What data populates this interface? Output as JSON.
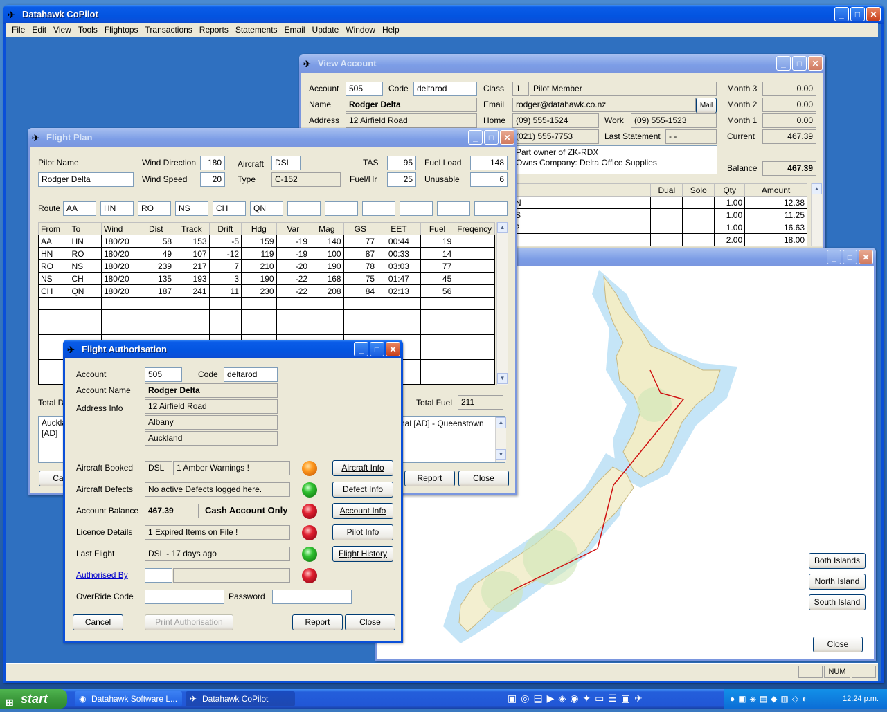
{
  "app": {
    "title": "Datahawk CoPilot"
  },
  "menu": [
    "File",
    "Edit",
    "View",
    "Tools",
    "Flightops",
    "Transactions",
    "Reports",
    "Statements",
    "Email",
    "Update",
    "Window",
    "Help"
  ],
  "view_account": {
    "title": "View Account",
    "account_label": "Account",
    "account": "505",
    "code_label": "Code",
    "code": "deltarod",
    "class_label": "Class",
    "class_no": "1",
    "class_name": "Pilot Member",
    "name_label": "Name",
    "name": "Rodger Delta",
    "email_label": "Email",
    "email": "rodger@datahawk.co.nz",
    "mail_btn": "Mail",
    "address_label": "Address",
    "address": "12 Airfield Road",
    "home_label": "Home",
    "home": "(09) 555-1524",
    "work_label": "Work",
    "work": "(09) 555-1523",
    "mobile": "(021) 555-7753",
    "last_statement_label": "Last Statement",
    "last_statement": "- -",
    "notes": [
      "Part owner of ZK-RDX",
      "Owns Company:  Delta Office Supplies"
    ],
    "month3_label": "Month 3",
    "month3": "0.00",
    "month2_label": "Month 2",
    "month2": "0.00",
    "month1_label": "Month 1",
    "month1": "0.00",
    "current_label": "Current",
    "current": "467.39",
    "balance_label": "Balance",
    "balance": "467.39",
    "table_headers": [
      "Dual",
      "Solo",
      "Qty",
      "Amount"
    ],
    "rows": [
      {
        "c": "N",
        "qty": "1.00",
        "amount": "12.38"
      },
      {
        "c": "S",
        "qty": "1.00",
        "amount": "11.25"
      },
      {
        "c": "2",
        "qty": "1.00",
        "amount": "16.63"
      },
      {
        "c": "",
        "qty": "2.00",
        "amount": "18.00"
      }
    ]
  },
  "flight_plan": {
    "title": "Flight Plan",
    "pilot_name_label": "Pilot Name",
    "pilot_name": "Rodger Delta",
    "wind_dir_label": "Wind Direction",
    "wind_dir": "180",
    "wind_speed_label": "Wind Speed",
    "wind_speed": "20",
    "aircraft_label": "Aircraft",
    "aircraft": "DSL",
    "type_label": "Type",
    "type": "C-152",
    "tas_label": "TAS",
    "tas": "95",
    "fuelhr_label": "Fuel/Hr",
    "fuelhr": "25",
    "fuel_load_label": "Fuel Load",
    "fuel_load": "148",
    "unusable_label": "Unusable",
    "unusable": "6",
    "route_label": "Route",
    "route": [
      "AA",
      "HN",
      "RO",
      "NS",
      "CH",
      "QN",
      "",
      "",
      "",
      "",
      "",
      ""
    ],
    "headers": [
      "From",
      "To",
      "Wind",
      "Dist",
      "Track",
      "Drift",
      "Hdg",
      "Var",
      "Mag",
      "GS",
      "EET",
      "Fuel",
      "Freqency"
    ],
    "legs": [
      [
        "AA",
        "HN",
        "180/20",
        "58",
        "153",
        "-5",
        "159",
        "-19",
        "140",
        "77",
        "00:44",
        "19",
        ""
      ],
      [
        "HN",
        "RO",
        "180/20",
        "49",
        "107",
        "-12",
        "119",
        "-19",
        "100",
        "87",
        "00:33",
        "14",
        ""
      ],
      [
        "RO",
        "NS",
        "180/20",
        "239",
        "217",
        "7",
        "210",
        "-20",
        "190",
        "78",
        "03:03",
        "77",
        ""
      ],
      [
        "NS",
        "CH",
        "180/20",
        "135",
        "193",
        "3",
        "190",
        "-22",
        "168",
        "75",
        "01:47",
        "45",
        ""
      ],
      [
        "CH",
        "QN",
        "180/20",
        "187",
        "241",
        "11",
        "230",
        "-22",
        "208",
        "84",
        "02:13",
        "56",
        ""
      ]
    ],
    "total_dist_label": "Total D",
    "total_fuel_label": "Total Fuel",
    "total_fuel": "211",
    "notes_left": [
      "Auckla",
      "[AD]"
    ],
    "notes_right": "nal [AD] - Queenstown",
    "cancel_btn": "Car",
    "report_btn": "Report",
    "close_btn": "Close"
  },
  "map_window": {
    "both_btn": "Both Islands",
    "north_btn": "North Island",
    "south_btn": "South Island",
    "close_btn": "Close"
  },
  "auth": {
    "title": "Flight Authorisation",
    "account_label": "Account",
    "account": "505",
    "code_label": "Code",
    "code": "deltarod",
    "account_name_label": "Account Name",
    "account_name": "Rodger Delta",
    "address_label": "Address Info",
    "address1": "12 Airfield Road",
    "address2": "Albany",
    "address3": "Auckland",
    "aircraft_booked_label": "Aircraft Booked",
    "aircraft_booked": "DSL",
    "aircraft_warning": "1 Amber Warnings !",
    "defects_label": "Aircraft Defects",
    "defects": "No active Defects logged here.",
    "balance_label": "Account Balance",
    "balance": "467.39",
    "cash_only": "Cash Account Only",
    "licence_label": "Licence Details",
    "licence": "1 Expired Items on File !",
    "last_flight_label": "Last Flight",
    "last_flight": "DSL - 17 days ago",
    "authorised_label": "Authorised By",
    "override_label": "OverRide Code",
    "password_label": "Password",
    "btn_aircraft": "Aircraft Info",
    "btn_defect": "Defect Info",
    "btn_account": "Account Info",
    "btn_pilot": "Pilot Info",
    "btn_history": "Flight History",
    "btn_cancel": "Cancel",
    "btn_print": "Print Authorisation",
    "btn_report": "Report",
    "btn_close": "Close"
  },
  "statusbar": {
    "num": "NUM"
  },
  "taskbar": {
    "start": "start",
    "task1": "Datahawk Software L...",
    "task2": "Datahawk CoPilot",
    "clock": "12:24 p.m."
  }
}
